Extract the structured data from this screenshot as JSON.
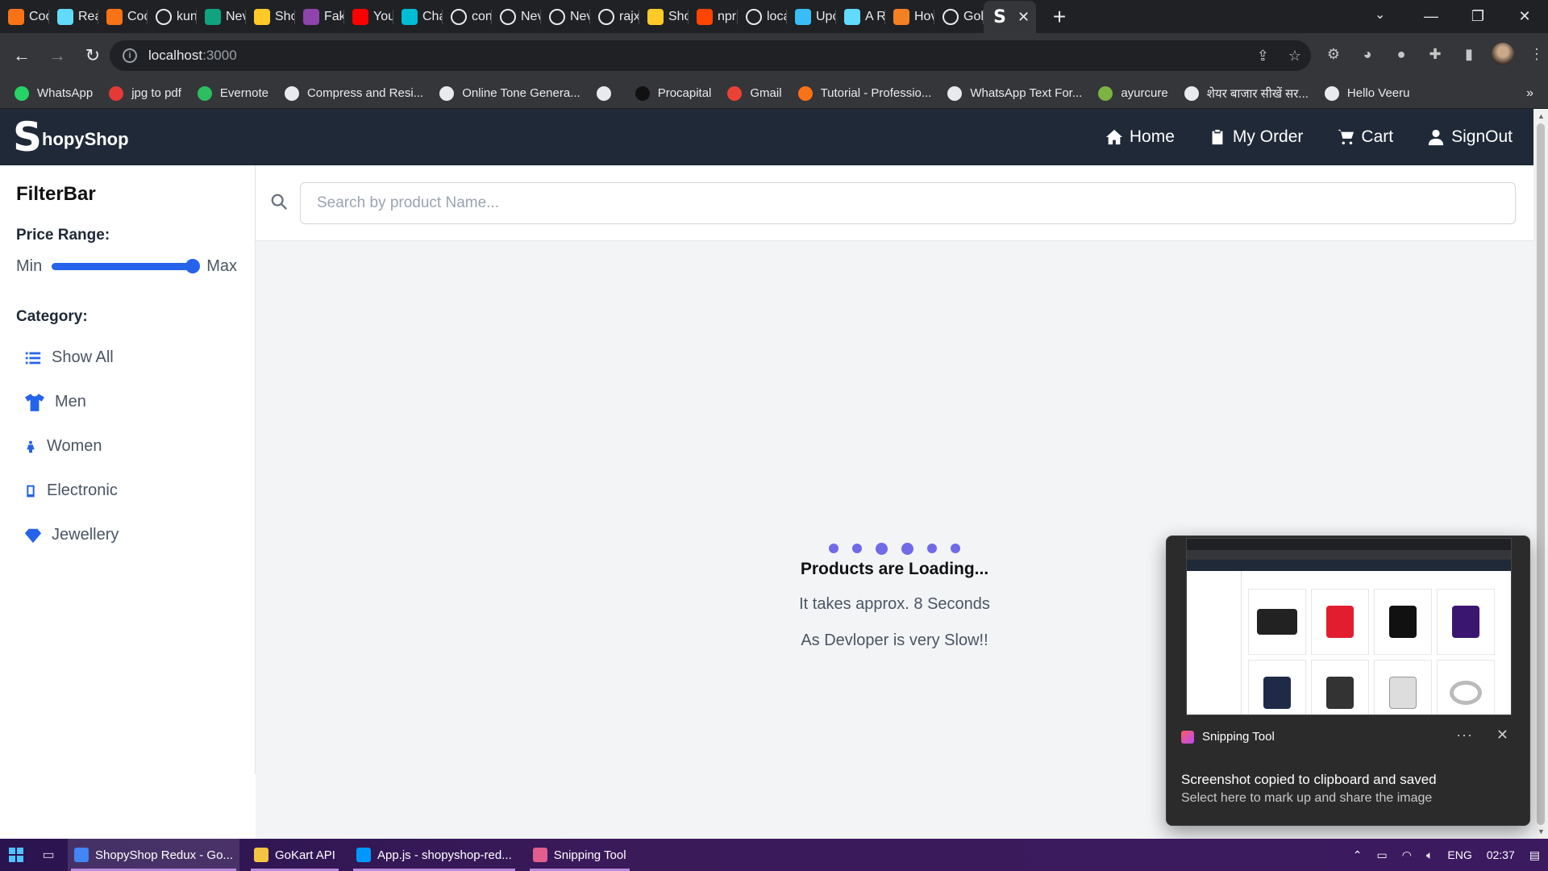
{
  "browser": {
    "tabs": [
      {
        "title": "Coo",
        "icon": "codepen-icon",
        "color": "#f97316"
      },
      {
        "title": "Rea",
        "icon": "react-icon",
        "color": "#61dafb"
      },
      {
        "title": "Coo",
        "icon": "codepen-icon",
        "color": "#f97316"
      },
      {
        "title": "kun",
        "icon": "github-icon",
        "color": "#ffffff"
      },
      {
        "title": "Nev",
        "icon": "chatgpt-icon",
        "color": "#10a37f"
      },
      {
        "title": "Sho",
        "icon": "firebase-icon",
        "color": "#ffca28"
      },
      {
        "title": "Fak",
        "icon": "fake-store-icon",
        "color": "#8e44ad"
      },
      {
        "title": "You",
        "icon": "youtube-icon",
        "color": "#ff0000"
      },
      {
        "title": "Cha",
        "icon": "chakra-icon",
        "color": "#00bcd4"
      },
      {
        "title": "con",
        "icon": "github-icon",
        "color": "#ffffff"
      },
      {
        "title": "Nev",
        "icon": "chrome-icon",
        "color": "#ffffff"
      },
      {
        "title": "Nev",
        "icon": "chrome-icon",
        "color": "#ffffff"
      },
      {
        "title": "rajx",
        "icon": "github-icon",
        "color": "#ffffff"
      },
      {
        "title": "Sho",
        "icon": "firebase-icon",
        "color": "#ffca28"
      },
      {
        "title": "npr",
        "icon": "reddit-icon",
        "color": "#ff4500"
      },
      {
        "title": "loca",
        "icon": "shopyshop-icon",
        "color": "#ffffff"
      },
      {
        "title": "Upc",
        "icon": "tailwind-icon",
        "color": "#38bdf8"
      },
      {
        "title": "A R",
        "icon": "react-icon",
        "color": "#61dafb"
      },
      {
        "title": "Hov",
        "icon": "stack-icon",
        "color": "#f48024"
      },
      {
        "title": "Gol",
        "icon": "github-icon",
        "color": "#ffffff"
      }
    ],
    "active_tab": {
      "icon": "shopyshop-icon",
      "close": "✕"
    },
    "new_tab": "+",
    "url": "localhost",
    "url_port": ":3000",
    "bookmarks": [
      {
        "label": "WhatsApp",
        "color": "#25d366"
      },
      {
        "label": "jpg to pdf",
        "color": "#e53935"
      },
      {
        "label": "Evernote",
        "color": "#2dbe60"
      },
      {
        "label": "Compress and Resi...",
        "color": "#e8eaed"
      },
      {
        "label": "Online Tone Genera...",
        "color": "#e8eaed"
      },
      {
        "label": "",
        "color": "#e8eaed"
      },
      {
        "label": "Procapital",
        "color": "#111111"
      },
      {
        "label": "Gmail",
        "color": "#ea4335"
      },
      {
        "label": "Tutorial - Professio...",
        "color": "#f97316"
      },
      {
        "label": "WhatsApp Text For...",
        "color": "#e8eaed"
      },
      {
        "label": "ayurcure",
        "color": "#7cb342"
      },
      {
        "label": "शेयर बाजार सीखें सर...",
        "color": "#e8eaed"
      },
      {
        "label": "Hello Veeru",
        "color": "#e8eaed"
      }
    ]
  },
  "app": {
    "brand_s": "S",
    "brand_rest": "hopyShop",
    "nav": [
      {
        "label": "Home",
        "icon": "home-icon"
      },
      {
        "label": "My Order",
        "icon": "clipboard-icon"
      },
      {
        "label": "Cart",
        "icon": "cart-icon"
      },
      {
        "label": "SignOut",
        "icon": "user-icon"
      }
    ],
    "filter": {
      "title": "FilterBar",
      "price_title": "Price Range:",
      "min_label": "Min",
      "max_label": "Max",
      "slider_value": 1.0,
      "category_title": "Category:",
      "categories": [
        {
          "label": "Show All",
          "icon": "list-icon"
        },
        {
          "label": "Men",
          "icon": "shirt-icon"
        },
        {
          "label": "Women",
          "icon": "woman-icon"
        },
        {
          "label": "Electronic",
          "icon": "mobile-icon"
        },
        {
          "label": "Jewellery",
          "icon": "gem-icon"
        }
      ]
    },
    "search": {
      "placeholder": "Search by product Name..."
    },
    "loading": {
      "title": "Products are Loading...",
      "line1": "It takes approx. 8 Seconds",
      "line2": "As Devloper is very Slow!!"
    },
    "colors": {
      "header": "#1f2937",
      "accent": "#2563eb",
      "loader": "#4f46e5"
    }
  },
  "toast": {
    "app_name": "Snipping Tool",
    "more": "···",
    "close": "✕",
    "message": "Screenshot copied to clipboard and saved",
    "sub_message": "Select here to mark up and share the image"
  },
  "taskbar": {
    "apps": [
      {
        "label": "ShopyShop Redux - Go...",
        "color": "#4285f4",
        "active": true
      },
      {
        "label": "GoKart API",
        "color": "#f4c542",
        "active": false
      },
      {
        "label": "App.js - shopyshop-red...",
        "color": "#0098ff",
        "active": false
      },
      {
        "label": "Snipping Tool",
        "color": "#e35d8f",
        "active": false
      }
    ],
    "lang": "ENG",
    "time": "02:37"
  }
}
